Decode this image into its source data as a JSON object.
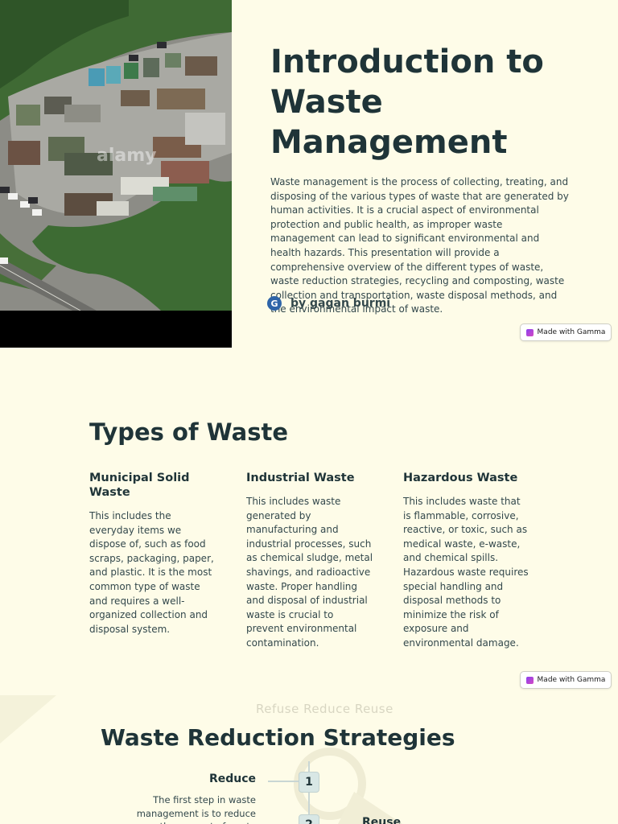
{
  "slide1": {
    "title": "Introduction to Waste Management",
    "body": "Waste management is the process of collecting, treating, and disposing of the various types of waste that are generated by human activities. It is a crucial aspect of environmental protection and public health, as improper waste management can lead to significant environmental and health hazards. This presentation will provide a comprehensive overview of the different types of waste, waste reduction strategies, recycling and composting, waste collection and transportation, waste disposal methods, and the environmental impact of waste.",
    "author_initial": "G",
    "author": "by gagan burmi",
    "badge": "Made with Gamma",
    "photo_watermark": "alamy",
    "photo_alt": "Aerial view of a recycling center"
  },
  "slide2": {
    "heading": "Types of Waste",
    "columns": [
      {
        "title": "Municipal Solid Waste",
        "text": "This includes the everyday items we dispose of, such as food scraps, packaging, paper, and plastic. It is the most common type of waste and requires a well-organized collection and disposal system."
      },
      {
        "title": "Industrial Waste",
        "text": "This includes waste generated by manufacturing and industrial processes, such as chemical sludge, metal shavings, and radioactive waste. Proper handling and disposal of industrial waste is crucial to prevent environmental contamination."
      },
      {
        "title": "Hazardous Waste",
        "text": "This includes waste that is flammable, corrosive, reactive, or toxic, such as medical waste, e-waste, and chemical spills. Hazardous waste requires special handling and disposal methods to minimize the risk of exposure and environmental damage."
      }
    ],
    "badge": "Made with Gamma"
  },
  "slide3": {
    "watermark": "Refuse Reduce Reuse",
    "heading": "Waste Reduction Strategies",
    "steps": [
      {
        "number": "1",
        "label": "Reduce",
        "text": "The first step in waste management is to reduce the amount of waste generated. This"
      },
      {
        "number": "2",
        "label": "Reuse"
      }
    ]
  },
  "colors": {
    "background": "#fefce8",
    "heading": "#1f3438",
    "body_text": "#33484c",
    "avatar": "#2e64a8",
    "timeline": "#c9d6d4"
  },
  "icons": [
    "gamma-logo-icon",
    "author-avatar-icon"
  ]
}
